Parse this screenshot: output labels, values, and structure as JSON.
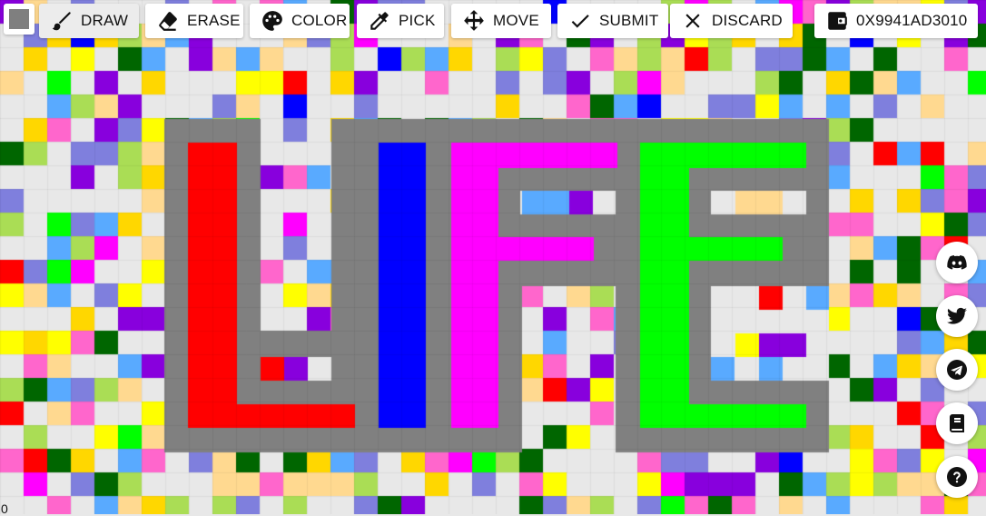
{
  "toolbar": {
    "current_color": "#7f7f7f",
    "draw_label": "DRAW",
    "erase_label": "ERASE",
    "color_label": "COLOR",
    "pick_label": "PICK",
    "move_label": "MOVE",
    "submit_label": "SUBMIT",
    "discard_label": "DISCARD",
    "wallet_label": "0X9941AD3010"
  },
  "status": {
    "counter": "0"
  },
  "sidebar": {
    "items": [
      {
        "icon": "discord-icon"
      },
      {
        "icon": "twitter-icon"
      },
      {
        "icon": "telegram-icon"
      },
      {
        "icon": "book-icon"
      },
      {
        "icon": "help-icon"
      }
    ]
  },
  "canvas": {
    "palette": [
      "#e8e8e8",
      "#ff0000",
      "#0000ff",
      "#ff00ff",
      "#00ff00",
      "#808080",
      "#ffff00",
      "#59aaff",
      "#8800dd",
      "#ff66cc",
      "#aadd55",
      "#ffd700",
      "#ffd990",
      "#7f7fdd",
      "#006600"
    ],
    "artwork": {
      "text": "LIFE",
      "letter_colors": [
        "#ff0000",
        "#0000ff",
        "#ff00ff",
        "#00ff00"
      ],
      "outline_color": "#808080"
    }
  }
}
